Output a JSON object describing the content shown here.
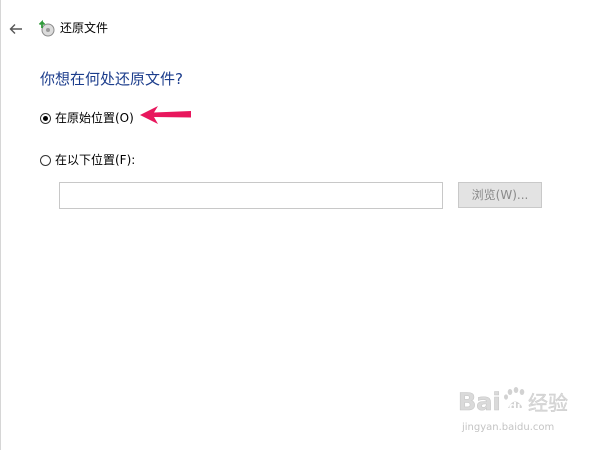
{
  "header": {
    "back_icon": "back-arrow-icon",
    "app_icon": "restore-files-icon",
    "title": "还原文件"
  },
  "main": {
    "heading": "你想在何处还原文件?",
    "options": [
      {
        "label": "在原始位置(O)",
        "selected": true
      },
      {
        "label": "在以下位置(F):",
        "selected": false
      }
    ],
    "location_input": {
      "value": "",
      "placeholder": ""
    },
    "browse_label": "浏览(W)..."
  },
  "annotation": {
    "arrow_color": "#e8175d"
  },
  "watermark": {
    "brand": "Baidu经验",
    "url": "jingyan.baidu.com"
  },
  "colors": {
    "heading": "#1c3d8c",
    "disabled_button_bg": "#e3e3e3",
    "disabled_button_text": "#8a8a8a"
  }
}
